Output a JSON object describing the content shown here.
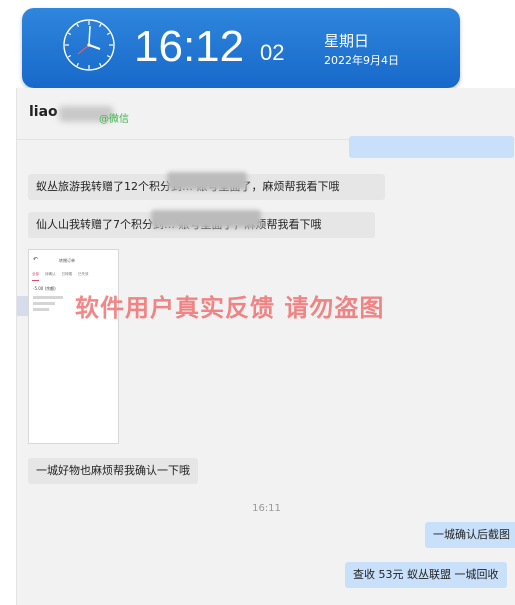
{
  "clock": {
    "time": "16:12",
    "seconds": "02",
    "weekday": "星期日",
    "date": "2022年9月4日"
  },
  "chat": {
    "contact_name": "liao",
    "contact_tag": "@微信",
    "messages": [
      {
        "side": "in",
        "text": "蚁丛旅游我转赠了12个积分到… 账号里面了，麻烦帮我看下哦"
      },
      {
        "side": "in",
        "text": "仙人山我转赠了7个积分到… 账号里面了，麻烦帮我看下哦"
      },
      {
        "side": "in",
        "text": "一城好物也麻烦帮我确认一下哦"
      }
    ],
    "timestamp": "16:11",
    "replies": [
      {
        "side": "out",
        "text": "一城确认后截图"
      },
      {
        "side": "out",
        "text": "查收   53元    蚁丛联盟 一城回收"
      }
    ],
    "screenshot": {
      "title": "转赠订单",
      "back_icon": "back-arrow-icon",
      "tabs": [
        "全部",
        "待确认",
        "已转赠",
        "已失效"
      ],
      "amount": "-5.00 (余额)"
    }
  },
  "watermark": "软件用户真实反馈  请勿盗图"
}
